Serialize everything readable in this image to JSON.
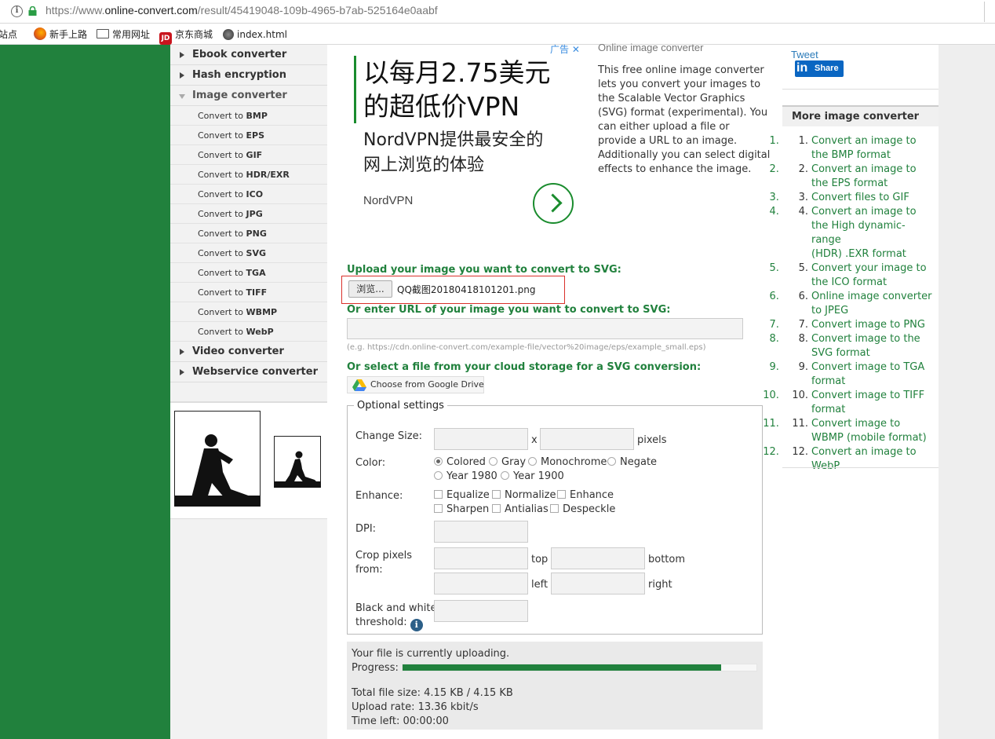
{
  "browser": {
    "url_prefix": "https://www.",
    "url_domain": "online-convert.com",
    "url_path": "/result/45419048-109b-4965-b7ab-525164e0aabf",
    "bookmarks": [
      "站点",
      "新手上路",
      "常用网址",
      "京东商城",
      "index.html"
    ]
  },
  "sidebar": {
    "top_items": [
      "Ebook converter",
      "Hash encryption",
      "Image converter"
    ],
    "sub_prefix": "Convert to",
    "formats": [
      "BMP",
      "EPS",
      "GIF",
      "HDR/EXR",
      "ICO",
      "JPG",
      "PNG",
      "SVG",
      "TGA",
      "TIFF",
      "WBMP",
      "WebP"
    ],
    "bottom_items": [
      "Video converter",
      "Webservice converter"
    ]
  },
  "ad": {
    "tag": "广告",
    "close": "✕",
    "headline_1": "以每月2.75美元",
    "headline_2": "的超低价VPN",
    "sub_1": "NordVPN提供最安全的",
    "sub_2": "网上浏览的体验",
    "brand": "NordVPN"
  },
  "description": {
    "title": "Online image converter",
    "text": "This free online image converter lets you convert your images to the Scalable Vector Graphics (SVG) format (experimental). You can either upload a file or provide a URL to an image. Additionally you can select digital effects to enhance the image."
  },
  "upload": {
    "label": "Upload your image you want to convert to SVG:",
    "browse": "浏览...",
    "filename": "QQ截图20180418101201.png",
    "url_label": "Or enter URL of your image you want to convert to SVG:",
    "url_value": "",
    "hint": "(e.g. https://cdn.online-convert.com/example-file/vector%20image/eps/example_small.eps)",
    "cloud_label": "Or select a file from your cloud storage for a SVG conversion:",
    "gdrive": "Choose from Google Drive"
  },
  "options": {
    "legend": "Optional settings",
    "change_size": "Change Size:",
    "x": "x",
    "pixels": "pixels",
    "color": "Color:",
    "colors": [
      "Colored",
      "Gray",
      "Monochrome",
      "Negate",
      "Year 1980",
      "Year 1900"
    ],
    "color_selected": "Colored",
    "enhance": "Enhance:",
    "enhancements": [
      "Equalize",
      "Normalize",
      "Enhance",
      "Sharpen",
      "Antialias",
      "Despeckle"
    ],
    "dpi": "DPI:",
    "crop_1": "Crop pixels",
    "crop_2": "from:",
    "top": "top",
    "bottom": "bottom",
    "left": "left",
    "right": "right",
    "bw_1": "Black and white",
    "bw_2": "threshold:"
  },
  "status": {
    "line1": "Your file is currently uploading.",
    "progress_label": "Progress:",
    "progress": 0.9,
    "total": "Total file size: 4.15 KB / 4.15 KB",
    "rate": "Upload rate: 13.36 kbit/s",
    "time": "Time left: 00:00:00"
  },
  "right": {
    "tweet": "Tweet",
    "share_in": "in",
    "share": "Share",
    "more_title": "More image converter",
    "more": [
      [
        "Convert an image to",
        "the BMP format"
      ],
      [
        "Convert an image to",
        "the EPS format"
      ],
      [
        "Convert files to GIF"
      ],
      [
        "Convert an image to",
        "the High dynamic-range",
        "(HDR) .EXR format"
      ],
      [
        "Convert your image to",
        "the ICO format"
      ],
      [
        "Online image converter",
        "to JPEG"
      ],
      [
        "Convert image to PNG"
      ],
      [
        "Convert image to the",
        "SVG format"
      ],
      [
        "Convert image to TGA",
        "format"
      ],
      [
        "Convert image to TIFF",
        "format"
      ],
      [
        "Convert image to",
        "WBMP (mobile format)"
      ],
      [
        "Convert an image to",
        "WebP"
      ]
    ]
  },
  "colors": {
    "brand_green": "#21813d",
    "red_highlight": "#d9302a",
    "link_blue": "#2b7bb9"
  }
}
